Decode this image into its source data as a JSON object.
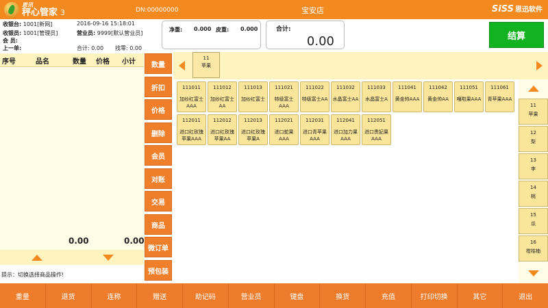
{
  "titlebar": {
    "brand": "思讯",
    "app_name": "秤心管家",
    "version": "3",
    "dn": "DN:00000000",
    "store": "宝安店",
    "vendor": "SiSS",
    "vendor_cn": "思迅软件"
  },
  "info": {
    "cashier_label": "收银台:",
    "cashier_value": "1001[新网]",
    "datetime": "2016-09-16 15:18:01",
    "cashier2_label": "收银员:",
    "cashier2_value": "1001[管理员]",
    "clerk_label": "营业员:",
    "clerk_value": "9999[默认营业员]",
    "member_label": "会  员:",
    "prev_label": "上一单:",
    "subtotal_label": "合计:",
    "subtotal_value": "0.00",
    "change_label": "找零:",
    "change_value": "0.00"
  },
  "scale": {
    "net_label": "净重:",
    "net_value": "0.000",
    "tare_label": "皮重:",
    "tare_value": "0.000"
  },
  "total": {
    "label": "合计:",
    "value": "0.00"
  },
  "settle_label": "结算",
  "list": {
    "col_seq": "序号",
    "col_name": "品名",
    "col_qty": "数量",
    "col_price": "价格",
    "col_subtotal": "小计",
    "sum_qty": "0.00",
    "sum_amount": "0.00"
  },
  "hint": "提示：切换选择商品操作!",
  "functions": [
    "数量",
    "折扣",
    "价格",
    "删除",
    "会员",
    "对账",
    "交易",
    "商品",
    "微订单",
    "预包装"
  ],
  "category": {
    "code": "11",
    "name": "苹果"
  },
  "products": [
    {
      "code": "111011",
      "name": "加纱红富士AAA"
    },
    {
      "code": "111012",
      "name": "加纱红富士AA"
    },
    {
      "code": "111013",
      "name": "加纱红富士"
    },
    {
      "code": "111021",
      "name": "特级富士AAA"
    },
    {
      "code": "111022",
      "name": "特级富士AA"
    },
    {
      "code": "111032",
      "name": "水晶富士AA"
    },
    {
      "code": "111033",
      "name": "水晶富士A"
    },
    {
      "code": "111041",
      "name": "黄金帅AAA"
    },
    {
      "code": "111042",
      "name": "黄金帅AA"
    },
    {
      "code": "111051",
      "name": "嘎啦果AAA"
    },
    {
      "code": "111061",
      "name": "青苹果AAA"
    },
    {
      "code": "112011",
      "name": "进口红玫瑰苹果AAA"
    },
    {
      "code": "112012",
      "name": "进口红玫瑰苹果AA"
    },
    {
      "code": "112013",
      "name": "进口红玫瑰苹果A"
    },
    {
      "code": "112021",
      "name": "进口蛇果AAA"
    },
    {
      "code": "112031",
      "name": "进口青苹果AAA"
    },
    {
      "code": "112041",
      "name": "进口加力果AAA"
    },
    {
      "code": "112051",
      "name": "进口贵妃果AAA"
    }
  ],
  "subcategories": [
    {
      "code": "11",
      "name": "苹果"
    },
    {
      "code": "12",
      "name": "梨"
    },
    {
      "code": "13",
      "name": "李"
    },
    {
      "code": "14",
      "name": "桃"
    },
    {
      "code": "15",
      "name": "瓜"
    },
    {
      "code": "16",
      "name": "柑桔柚"
    }
  ],
  "toolbar": [
    "重量",
    "退货",
    "连称",
    "赠送",
    "助记码",
    "营业员",
    "键盘",
    "换货",
    "充值",
    "打印切换",
    "其它",
    "退出"
  ],
  "colors": {
    "accent": "#f38a1f",
    "settle": "#11b320",
    "tile": "#fbe59a"
  }
}
